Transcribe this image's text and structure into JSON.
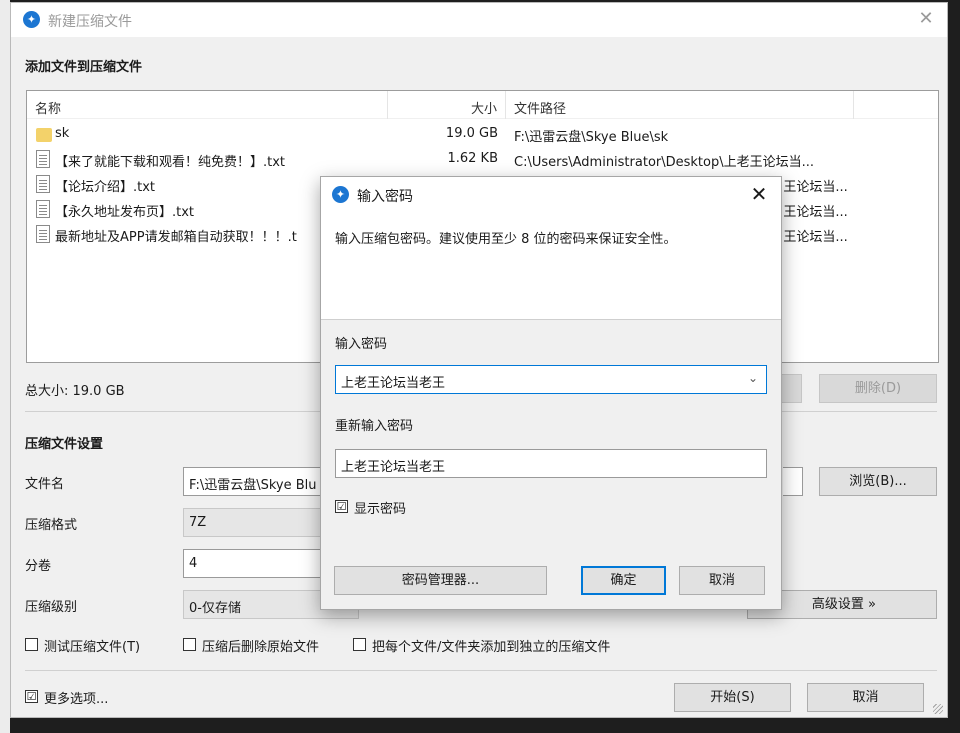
{
  "window": {
    "title": "新建压缩文件",
    "close_glyph": "✕",
    "app_icon": "app-logo-icon"
  },
  "add_files": {
    "section_title": "添加文件到压缩文件",
    "columns": {
      "name": "名称",
      "size": "大小",
      "path": "文件路径"
    },
    "files": [
      {
        "icon": "folder-icon",
        "name": "sk",
        "size": "19.0 GB",
        "path": "F:\\迅雷云盘\\Skye Blue\\sk"
      },
      {
        "icon": "text-file-icon",
        "name": "【来了就能下载和观看！纯免费！】.txt",
        "size": "1.62 KB",
        "path": "C:\\Users\\Administrator\\Desktop\\上老王论坛当..."
      },
      {
        "icon": "text-file-icon",
        "name": "【论坛介绍】.txt",
        "size": "",
        "path": "...王论坛当..."
      },
      {
        "icon": "text-file-icon",
        "name": "【永久地址发布页】.txt",
        "size": "",
        "path": "...王论坛当..."
      },
      {
        "icon": "text-file-icon",
        "name": "最新地址及APP请发邮箱自动获取！！！.t",
        "size": "",
        "path": "...王论坛当..."
      }
    ],
    "total_size": "总大小: 19.0 GB",
    "delete_button": "删除(D)"
  },
  "settings": {
    "section_title": "压缩文件设置",
    "filename_label": "文件名",
    "filename_value": "F:\\迅雷云盘\\Skye Blu",
    "browse_button": "浏览(B)...",
    "format_label": "压缩格式",
    "format_value": "7Z",
    "split_label": "分卷",
    "split_value": "4",
    "level_label": "压缩级别",
    "level_value": "0-仅存储",
    "advanced_button": "高级设置 »",
    "test_archive": "测试压缩文件(T)",
    "delete_after": "压缩后删除原始文件",
    "separate_archives": "把每个文件/文件夹添加到独立的压缩文件",
    "more_options": "更多选项...",
    "more_options_checked": "☑",
    "start_button": "开始(S)",
    "cancel_button": "取消"
  },
  "password_dialog": {
    "title": "输入密码",
    "close_glyph": "✕",
    "description": "输入压缩包密码。建议使用至少 8 位的密码来保证安全性。",
    "password_label": "输入密码",
    "password_value": "上老王论坛当老王",
    "reenter_label": "重新输入密码",
    "reenter_value": "上老王论坛当老王",
    "show_password": "显示密码",
    "show_password_checked": "☑",
    "manager_button": "密码管理器...",
    "ok_button": "确定",
    "cancel_button": "取消",
    "dropdown_glyph": "⌄"
  }
}
